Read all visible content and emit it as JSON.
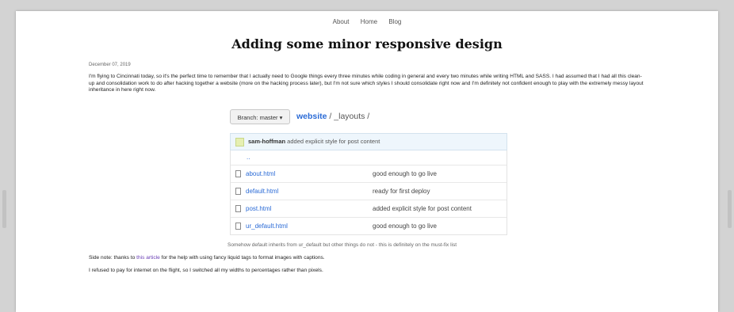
{
  "nav": [
    "About",
    "Home",
    "Blog"
  ],
  "post": {
    "title": "Adding some minor responsive design",
    "date": "December 07, 2019",
    "intro": "I'm flying to Cincinnati today, so it's the perfect time to remember that I actually need to Google things every three minutes while coding in general and every two minutes while writing HTML and SASS. I had assumed that I had all this clean-up and consolidation work to do after hacking together a website (more on the hacking process later), but I'm not sure which styles I should consolidate right now and I'm definitely not confident enough to play with the extremely messy layout inheritance in here right now.",
    "caption": "Somehow default inherits from ur_default but other things do not - this is definitely on the must-fix list",
    "side_note_prefix": "Side note: thanks to ",
    "side_note_link": "this article",
    "side_note_suffix": " for the help with using fancy liquid tags to format images with captions.",
    "last": "I refused to pay for internet on the flight, so I switched all my widths to percentages rather than pixels."
  },
  "repo": {
    "branch_label": "Branch: master ▾",
    "repo_name": "website",
    "path": " / _layouts /",
    "commit_author": "sam-hoffman",
    "commit_message": " added explicit style for post content",
    "parent_dir": "..",
    "files": [
      {
        "name": "about.html",
        "message": "good enough to go live"
      },
      {
        "name": "default.html",
        "message": "ready for first deploy"
      },
      {
        "name": "post.html",
        "message": "added explicit style for post content"
      },
      {
        "name": "ur_default.html",
        "message": "good enough to go live"
      }
    ]
  }
}
